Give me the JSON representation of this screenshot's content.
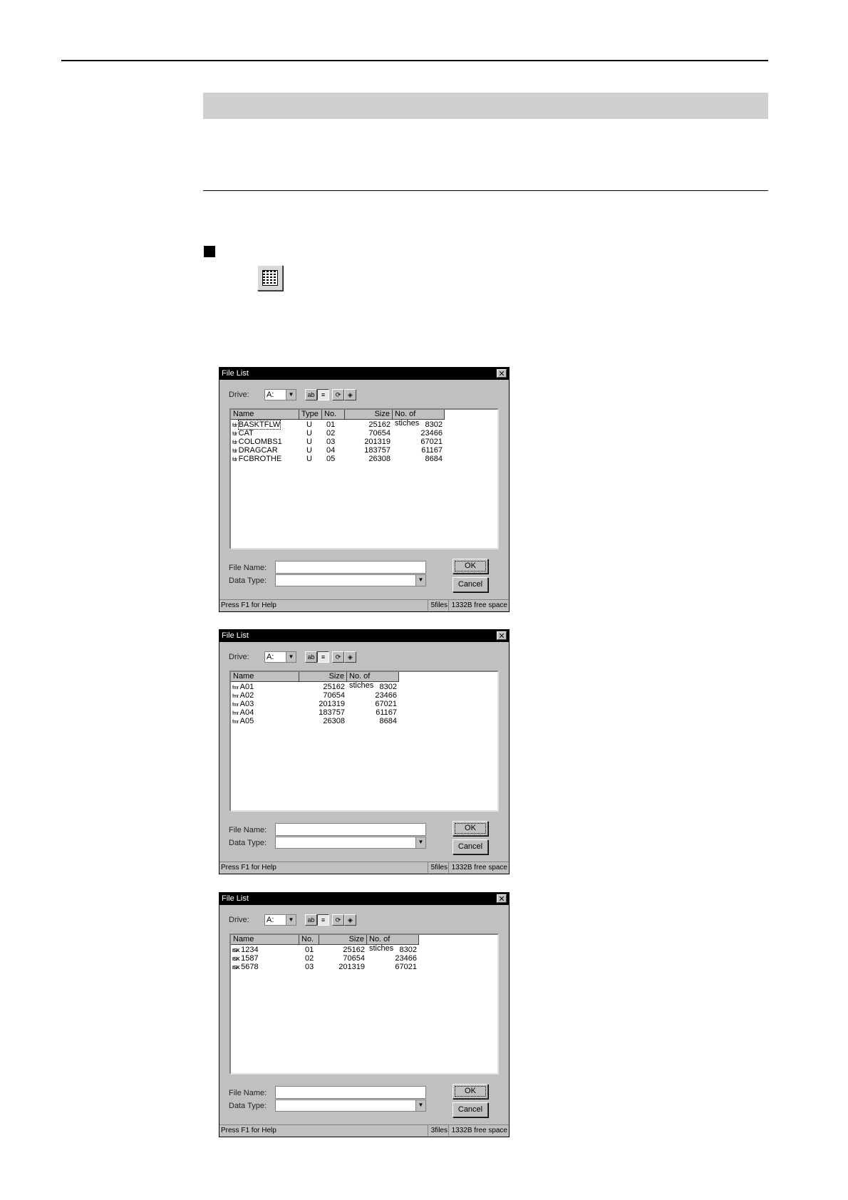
{
  "windows": [
    {
      "title": "File List",
      "drive_label": "Drive:",
      "drive_value": "A:",
      "columns": [
        "Name",
        "Type",
        "No.",
        "Size",
        "No. of stiches"
      ],
      "rows": [
        {
          "icon": "fdr",
          "name": "BASKTFLW",
          "type": "U",
          "no": "01",
          "size": "25162",
          "stitches": "8302"
        },
        {
          "icon": "fdr",
          "name": "CAT",
          "type": "U",
          "no": "02",
          "size": "70654",
          "stitches": "23466"
        },
        {
          "icon": "fdr",
          "name": "COLOMBS1",
          "type": "U",
          "no": "03",
          "size": "201319",
          "stitches": "67021"
        },
        {
          "icon": "fdr",
          "name": "DRAGCAR",
          "type": "U",
          "no": "04",
          "size": "183757",
          "stitches": "61167"
        },
        {
          "icon": "fdr",
          "name": "FCBROTHE",
          "type": "U",
          "no": "05",
          "size": "26308",
          "stitches": "8684"
        }
      ],
      "file_name_label": "File Name:",
      "data_type_label": "Data Type:",
      "ok_label": "OK",
      "cancel_label": "Cancel",
      "status_help": "Press F1 for Help",
      "status_files": "5files",
      "status_space": "1332B free space"
    },
    {
      "title": "File List",
      "drive_label": "Drive:",
      "drive_value": "A:",
      "columns": [
        "Name",
        "Size",
        "No. of stiches"
      ],
      "rows": [
        {
          "icon": "fmr",
          "name": "A01",
          "size": "25162",
          "stitches": "8302"
        },
        {
          "icon": "fmr",
          "name": "A02",
          "size": "70654",
          "stitches": "23466"
        },
        {
          "icon": "fmr",
          "name": "A03",
          "size": "201319",
          "stitches": "67021"
        },
        {
          "icon": "fmr",
          "name": "A04",
          "size": "183757",
          "stitches": "61167"
        },
        {
          "icon": "fmr",
          "name": "A05",
          "size": "26308",
          "stitches": "8684"
        }
      ],
      "file_name_label": "File Name:",
      "data_type_label": "Data Type:",
      "ok_label": "OK",
      "cancel_label": "Cancel",
      "status_help": "Press F1 for Help",
      "status_files": "5files",
      "status_space": "1332B free space"
    },
    {
      "title": "File List",
      "drive_label": "Drive:",
      "drive_value": "A:",
      "columns": [
        "Name",
        "No.",
        "Size",
        "No. of stiches"
      ],
      "rows": [
        {
          "icon": "ISK",
          "name": "1234",
          "no": "01",
          "size": "25162",
          "stitches": "8302"
        },
        {
          "icon": "ISK",
          "name": "1587",
          "no": "02",
          "size": "70654",
          "stitches": "23466"
        },
        {
          "icon": "ISK",
          "name": "5678",
          "no": "03",
          "size": "201319",
          "stitches": "67021"
        }
      ],
      "file_name_label": "File Name:",
      "data_type_label": "Data Type:",
      "ok_label": "OK",
      "cancel_label": "Cancel",
      "status_help": "Press F1 for Help",
      "status_files": "3files",
      "status_space": "1332B free space"
    }
  ]
}
